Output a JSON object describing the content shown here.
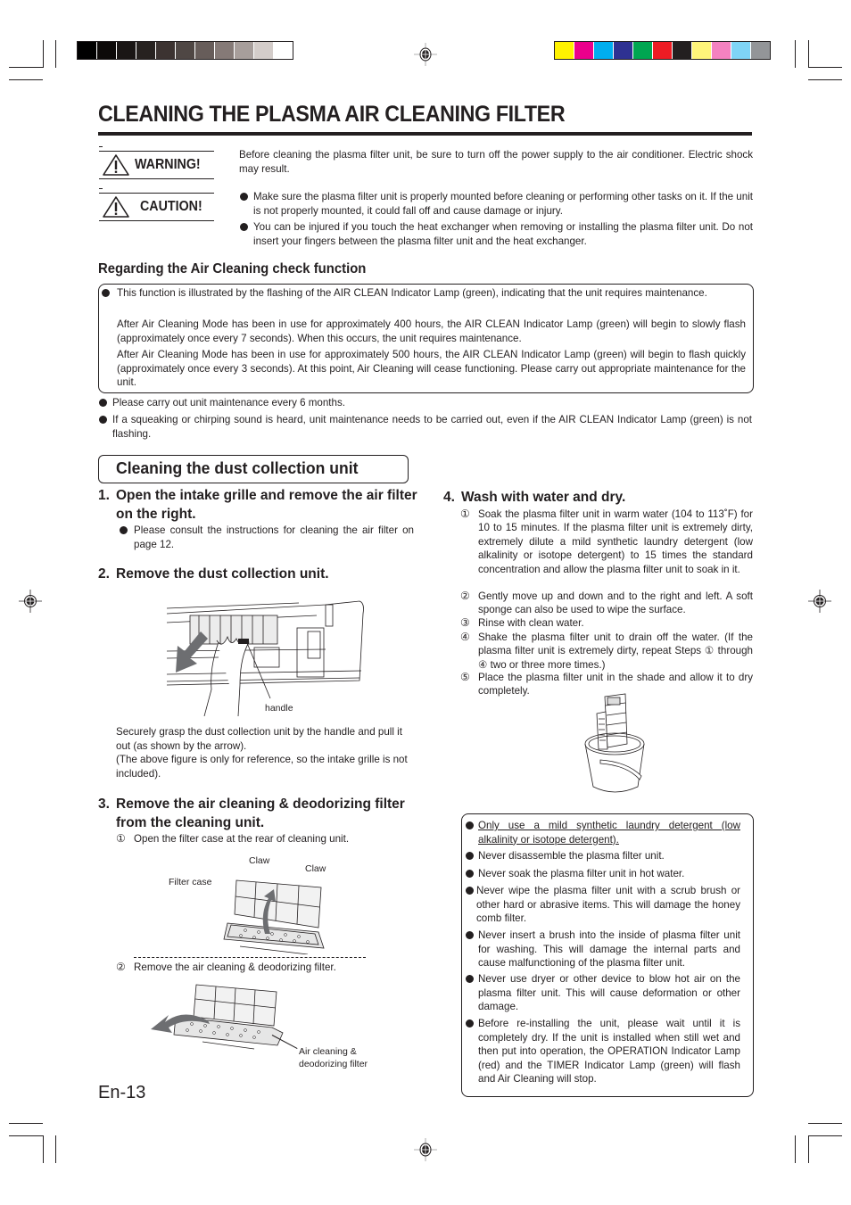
{
  "print_marks": {
    "gray_swatches": [
      "#000000",
      "#0d0a09",
      "#1a1615",
      "#272220",
      "#3c3331",
      "#4f4744",
      "#675d5a",
      "#857a77",
      "#a79e9b",
      "#d4cdca",
      "#ffffff"
    ],
    "color_swatches": [
      "#fff200",
      "#ec008c",
      "#00aeef",
      "#2e3192",
      "#00a651",
      "#ed1c24",
      "#231f20",
      "#fff57a",
      "#f482c0",
      "#7fd4f6",
      "#939598"
    ]
  },
  "page": {
    "title": "CLEANING THE PLASMA AIR CLEANING FILTER",
    "page_number": "En-13"
  },
  "warning": {
    "label": "WARNING!",
    "text": "Before cleaning the plasma filter unit, be sure to turn off the power supply to the air conditioner. Electric shock may result."
  },
  "caution": {
    "label": "CAUTION!",
    "items": [
      "Make sure the plasma filter unit is properly mounted before cleaning or performing other tasks on it. If the unit is not properly mounted, it could fall off and cause damage or injury.",
      "You can be injured if you touch the heat exchanger when removing or installing the plasma filter unit. Do not insert your fingers between the plasma filter unit and the heat exchanger."
    ]
  },
  "check_function": {
    "heading": "Regarding the Air Cleaning check function",
    "box_bullet": "This function is illustrated by the flashing of the AIR CLEAN Indicator Lamp (green), indicating that the unit requires maintenance.",
    "box_para1": "After Air Cleaning Mode has been in use for approximately 400 hours, the AIR CLEAN Indicator Lamp (green) will begin to slowly flash (approximately once every 7 seconds). When this occurs, the unit requires maintenance.",
    "box_para2": "After Air Cleaning Mode has been in use for approximately 500 hours, the AIR CLEAN Indicator Lamp (green) will begin to flash quickly (approximately once every 3 seconds). At this point, Air Cleaning will cease functioning. Please carry out appropriate maintenance for the unit.",
    "notes": [
      "Please carry out unit maintenance every 6 months.",
      "If a squeaking or chirping sound is heard,  unit maintenance needs to be carried out, even if the AIR CLEAN Indicator Lamp (green) is not flashing."
    ]
  },
  "dust_section": {
    "heading": "Cleaning the dust collection unit",
    "step1": {
      "num": "1.",
      "title": "Open the intake grille and remove the air filter on the right.",
      "note": "Please consult the instructions for cleaning the air filter on page 12."
    },
    "step2": {
      "num": "2.",
      "title": "Remove the dust collection unit.",
      "figure_label": "handle",
      "desc1": "Securely grasp the dust collection unit by the handle and pull it out (as shown by the arrow).",
      "desc2": "(The above figure is only for reference, so the intake grille is not included)."
    },
    "step3": {
      "num": "3.",
      "title": "Remove the air cleaning & deodorizing filter from the cleaning unit.",
      "sub1_mark": "①",
      "sub1": "Open the filter case at the rear of cleaning unit.",
      "fig1_labels": {
        "claw1": "Claw",
        "claw2": "Claw",
        "filter_case": "Filter case"
      },
      "sub2_mark": "②",
      "sub2": "Remove the air cleaning & deodorizing filter.",
      "fig2_label_line1": "Air cleaning &",
      "fig2_label_line2": "deodorizing filter"
    },
    "step4": {
      "num": "4.",
      "title": "Wash with water and dry.",
      "subs": [
        {
          "mark": "①",
          "text": "Soak the plasma filter unit in warm water (104 to 113˚F) for 10 to 15 minutes. If the plasma filter unit is extremely dirty, extremely dilute a mild synthetic laundry detergent (low alkalinity or isotope detergent) to 15 times the standard concentration and allow the plasma filter unit to soak in it."
        },
        {
          "mark": "②",
          "text": "Gently move up and down and to the right and left. A soft sponge can also be used to wipe the surface."
        },
        {
          "mark": "③",
          "text": "Rinse with clean water."
        },
        {
          "mark": "④",
          "text": "Shake the plasma filter unit to drain off the water. (If the plasma filter unit is extremely dirty, repeat Steps ① through ④ two or three more times.)"
        },
        {
          "mark": "⑤",
          "text": "Place the plasma filter unit in the shade and allow it to dry completely."
        }
      ]
    },
    "notes_box": [
      "Only use a mild synthetic laundry detergent (low alkalinity or isotope detergent).",
      "Never disassemble the plasma filter unit.",
      "Never soak the plasma filter unit in hot water.",
      "Never wipe the plasma filter unit with a scrub brush or other hard or abrasive items. This will damage the honey comb filter.",
      "Never insert a brush into the inside of plasma filter unit for washing. This will damage the internal parts and cause malfunctioning of the plasma filter unit.",
      "Never use dryer or other device to blow hot air on the plasma filter unit. This will cause deformation or other damage.",
      "Before re-installing the unit, please wait until it is completely dry. If the unit is installed when still wet and then put into operation, the OPERATION Indicator Lamp (red) and the TIMER Indicator Lamp (green) will flash and Air Cleaning will stop."
    ]
  }
}
